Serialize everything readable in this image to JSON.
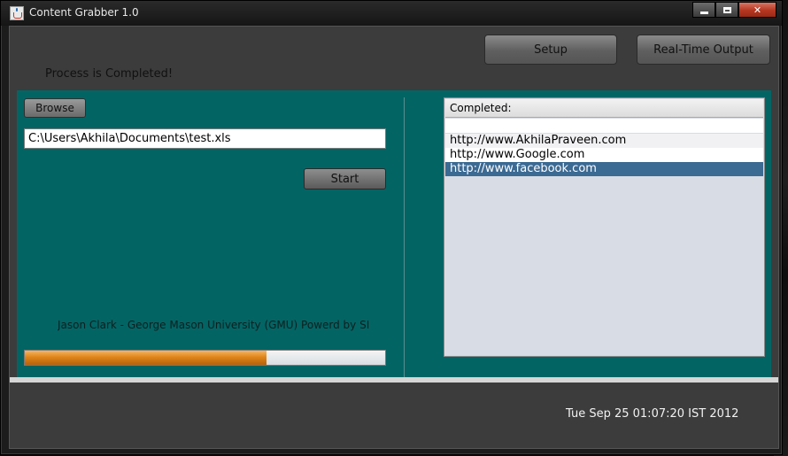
{
  "window": {
    "title": "Content Grabber 1.0"
  },
  "status": {
    "message": "Process is Completed!"
  },
  "toolbar": {
    "setup_label": "Setup",
    "realtime_label": "Real-Time Output"
  },
  "input_panel": {
    "browse_label": "Browse",
    "file_path": "C:\\Users\\Akhila\\Documents\\test.xls",
    "start_label": "Start",
    "credit": "Jason Clark - George Mason University (GMU) Powerd by SI",
    "progress_fraction": 0.67
  },
  "completed_list": {
    "header": "Completed:",
    "items": [
      "http://www.AkhilaPraveen.com",
      "http://www.Google.com",
      "http://www.facebook.com"
    ],
    "selected_index": 2
  },
  "footer": {
    "datetime": "Tue Sep 25 01:07:20 IST 2012"
  },
  "colors": {
    "panel_teal": "#036464",
    "selection": "#3b6a93",
    "progress_fill": "#e0861b"
  }
}
